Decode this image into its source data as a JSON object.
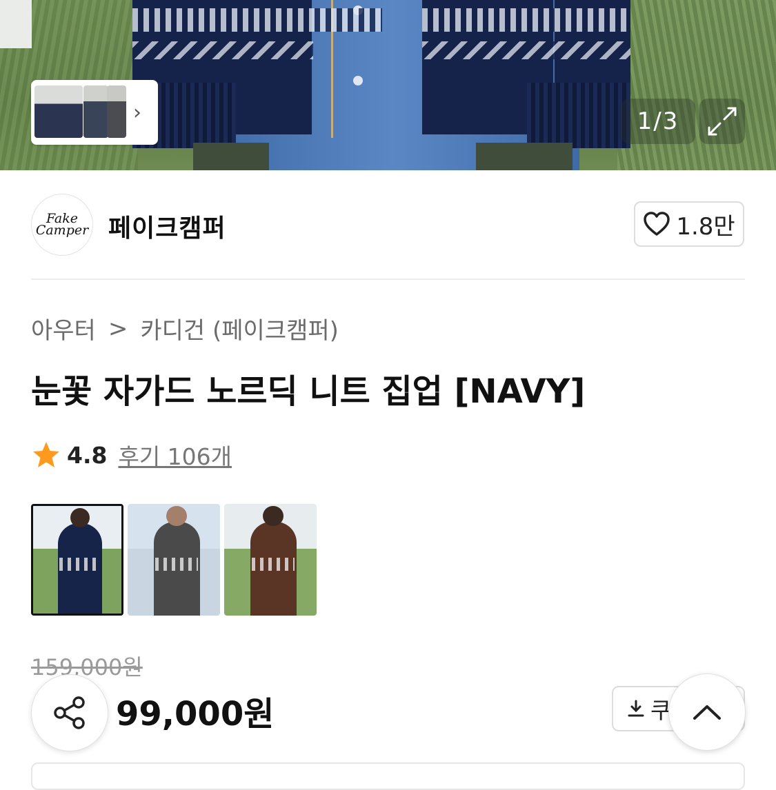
{
  "gallery": {
    "counter_current": "1",
    "counter_sep": "/",
    "counter_total": "3",
    "icons": {
      "next": "chevron-right-icon",
      "expand": "expand-icon"
    }
  },
  "brand": {
    "logo_line1": "Fake",
    "logo_line2": "Camper",
    "name": "페이크캠퍼",
    "like_count": "1.8만"
  },
  "breadcrumb": {
    "category": "아우터",
    "separator": ">",
    "subcategory": "카디건 (페이크캠퍼)"
  },
  "product": {
    "title": "눈꽃 자가드 노르딕 니트 집업 [NAVY]",
    "rating": "4.8",
    "reviews": "후기 106개",
    "original_price": "159,000원",
    "sale_price": "99,000원"
  },
  "variants": [
    {
      "color": "navy",
      "selected": true
    },
    {
      "color": "charcoal",
      "selected": false
    },
    {
      "color": "brown",
      "selected": false
    }
  ],
  "actions": {
    "coupon_label": "쿠"
  },
  "colors": {
    "star": "#ff9a1f",
    "text": "#111111",
    "muted": "#6b6b6b"
  }
}
